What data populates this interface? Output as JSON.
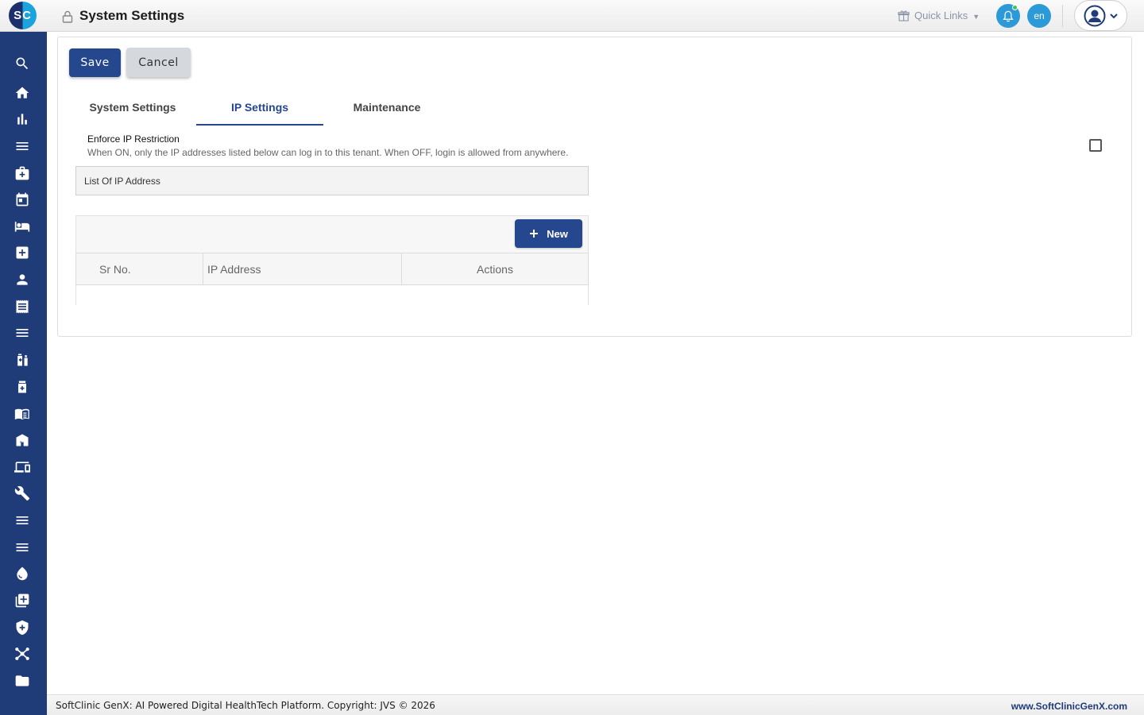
{
  "header": {
    "logo_text": "SC",
    "title": "System Settings",
    "quick_links_label": "Quick Links",
    "language": "en",
    "accent_color": "#2c9ad6"
  },
  "sidebar": {
    "background": "#1f3b78",
    "items": [
      {
        "icon": "search-icon"
      },
      {
        "icon": "home-icon"
      },
      {
        "icon": "bar-chart-icon"
      },
      {
        "icon": "menu-icon"
      },
      {
        "icon": "medical-bag-icon"
      },
      {
        "icon": "calendar-icon"
      },
      {
        "icon": "bed-icon"
      },
      {
        "icon": "medical-plus-icon"
      },
      {
        "icon": "person-icon"
      },
      {
        "icon": "receipt-icon"
      },
      {
        "icon": "menu-icon"
      },
      {
        "icon": "medication-icon"
      },
      {
        "icon": "medicine-box-icon"
      },
      {
        "icon": "book-icon"
      },
      {
        "icon": "store-icon"
      },
      {
        "icon": "devices-icon"
      },
      {
        "icon": "wrench-icon"
      },
      {
        "icon": "menu-icon"
      },
      {
        "icon": "menu-icon"
      },
      {
        "icon": "blood-drop-icon"
      },
      {
        "icon": "add-collection-icon"
      },
      {
        "icon": "shield-plus-icon"
      },
      {
        "icon": "hub-icon"
      },
      {
        "icon": "folder-icon"
      }
    ]
  },
  "toolbar": {
    "save_label": "Save",
    "cancel_label": "Cancel"
  },
  "tabs": [
    {
      "label": "System Settings",
      "active": false
    },
    {
      "label": "IP Settings",
      "active": true
    },
    {
      "label": "Maintenance",
      "active": false
    }
  ],
  "ip_settings": {
    "enforce_label": "Enforce IP Restriction",
    "enforce_help": "When ON, only the IP addresses listed below can log in to this tenant. When OFF, login is allowed from anywhere.",
    "enforce_checked": false,
    "list_title": "List Of IP Address",
    "new_button_label": "New",
    "columns": [
      "Sr No.",
      "IP Address",
      "Actions"
    ],
    "rows": []
  },
  "footer": {
    "copyright": "SoftClinic GenX: AI Powered Digital HealthTech Platform. Copyright: JVS © 2026",
    "website": "www.SoftClinicGenX.com"
  }
}
